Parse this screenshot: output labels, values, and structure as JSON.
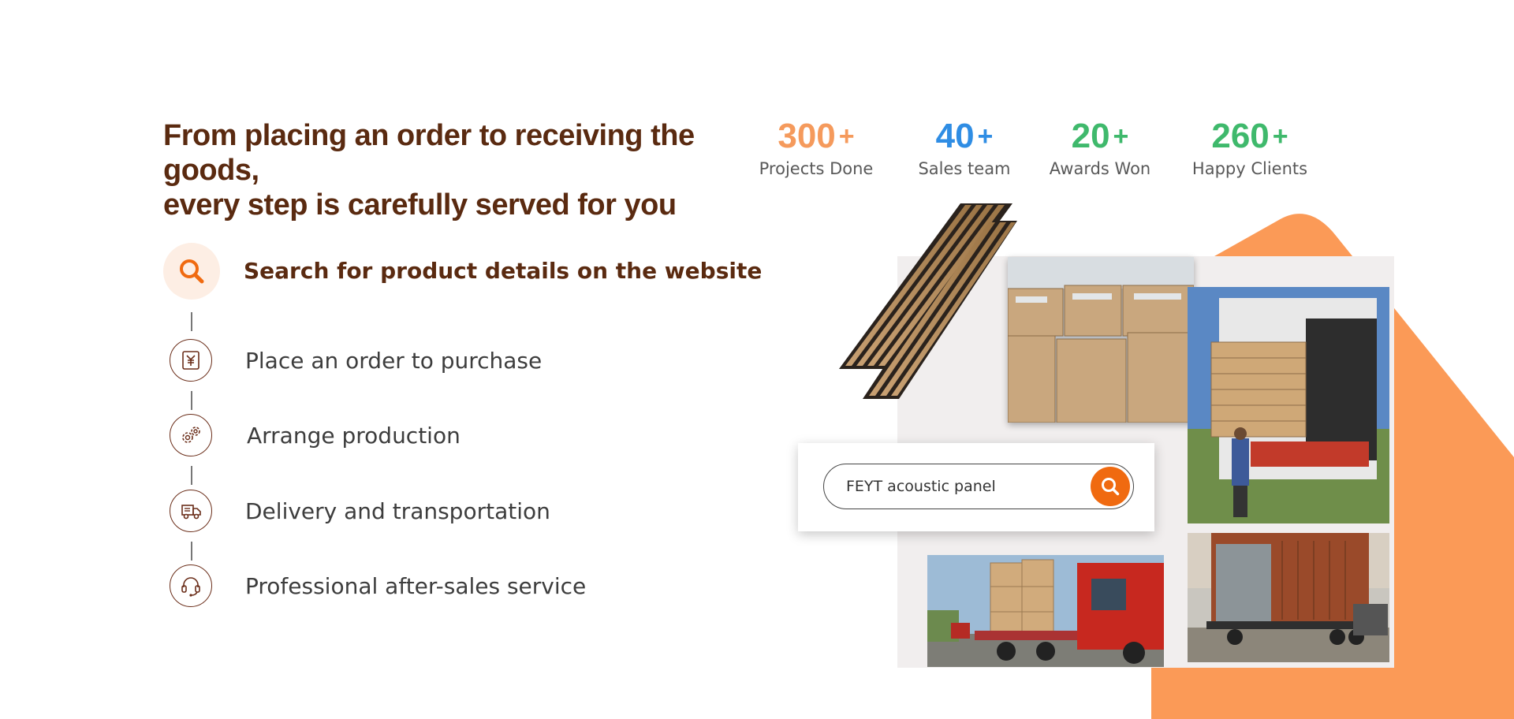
{
  "headline": {
    "line1": "From placing an order to receiving the goods,",
    "line2": "every step is carefully served for you"
  },
  "stats": [
    {
      "value": "300",
      "suffix": "+",
      "label": "Projects Done",
      "color": "#f59a5c"
    },
    {
      "value": "40",
      "suffix": "+",
      "label": "Sales team",
      "color": "#2f8de4"
    },
    {
      "value": "20",
      "suffix": "+",
      "label": "Awards Won",
      "color": "#3fb96c"
    },
    {
      "value": "260",
      "suffix": "+",
      "label": "Happy Clients",
      "color": "#3fb96c"
    }
  ],
  "steps": [
    {
      "label": "Search for product details on the website",
      "icon": "search-icon",
      "active": true
    },
    {
      "label": "Place an order to purchase",
      "icon": "yuan-purchase-icon",
      "active": false
    },
    {
      "label": "Arrange production",
      "icon": "gears-icon",
      "active": false
    },
    {
      "label": "Delivery and transportation",
      "icon": "truck-icon",
      "active": false
    },
    {
      "label": "Professional after-sales service",
      "icon": "headset-icon",
      "active": false
    }
  ],
  "search": {
    "query": "FEYT acoustic panel",
    "button_icon": "search-icon"
  },
  "colors": {
    "brand_brown": "#5a2a10",
    "accent_orange": "#f06a10",
    "shape_orange": "#fb9a57"
  }
}
